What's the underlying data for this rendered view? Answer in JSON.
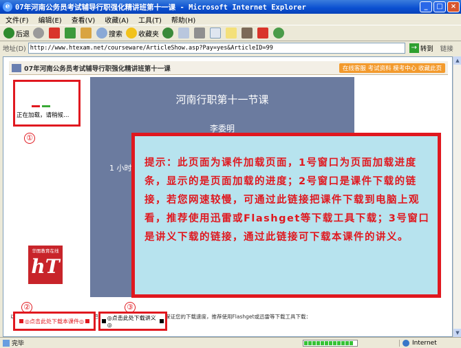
{
  "window": {
    "title": "07年河南公务员考试辅导行职强化精讲班第十一课 - Microsoft Internet Explorer",
    "minimize": "_",
    "maximize": "□",
    "close": "×"
  },
  "menu": [
    "文件(F)",
    "编辑(E)",
    "查看(V)",
    "收藏(A)",
    "工具(T)",
    "帮助(H)"
  ],
  "toolbar": {
    "back": "后退",
    "search": "搜索",
    "favorites": "收藏夹"
  },
  "address": {
    "label": "地址(D)",
    "url": "http://www.htexam.net/courseware/ArticleShow.asp?Pay=yes&ArticleID=99",
    "go": "转到",
    "links": "链接"
  },
  "page": {
    "title": "07年河南公务员考试辅导行职强化精讲班第十一课",
    "top_links": "在线客服  考试资料  模考中心  收藏此页",
    "loading_text": "正在加载，请稍候…",
    "num1": "①",
    "num2": "②",
    "num3": "③"
  },
  "slide": {
    "heading": "河南行职第十一节课",
    "author": "李委明",
    "line": "1 小时"
  },
  "logo": {
    "top_text": "华图教育在线",
    "mark": "hT"
  },
  "notice": {
    "text": "提示：此页面为课件加载页面，1号窗口为页面加载进度条，显示的是页面加载的进度；2号窗口是课件下载的链接，若您网速较慢，可通过此链接把课件下载到电脑上观看，推荐使用迅雷或Flashget等下载工具下载；3号窗口是讲义下载的链接，通过此链接可下载本课件的讲义。"
  },
  "downloads": {
    "hint": "以下二链接可下载课件，但要求客户把课件下载到电脑上观看，为了保证您的下载速度，推荐使用Flashget或迅雷等下载工具下载：",
    "courseware": "◎点击此处下载本课件◎",
    "handout": "◎点击此处下载讲义◎"
  },
  "status": {
    "left": "完毕",
    "zone": "Internet",
    "progress": 0.95
  },
  "colors": {
    "accent_red": "#e0181f",
    "notice_bg": "#b7e3ee",
    "slide_bg": "#6b7b9f"
  }
}
